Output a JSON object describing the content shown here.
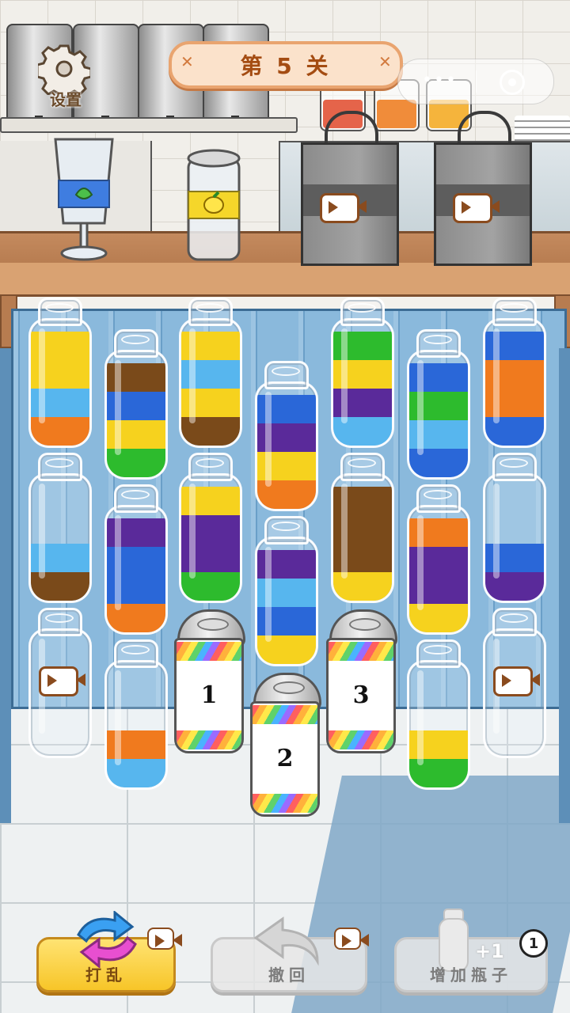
{
  "header": {
    "level_title": "第 5 关",
    "settings_label": "设置"
  },
  "bottles": [
    {
      "id": 1,
      "layers": [
        "#f07a1e",
        "#57b6ee",
        "#f6d21e",
        "#f6d21e"
      ]
    },
    {
      "id": 2,
      "layers": [
        "#2dbb2d",
        "#f6d21e",
        "#2a67d8",
        "#7a4a1a"
      ]
    },
    {
      "id": 3,
      "layers": [
        "#7a4a1a",
        "#f6d21e",
        "#57b6ee",
        "#f6d21e"
      ]
    },
    {
      "id": 4,
      "layers": [
        "#f07a1e",
        "#f6d21e",
        "#5a2a9a",
        "#2a67d8"
      ]
    },
    {
      "id": 5,
      "layers": [
        "#2dbb2d",
        "#5a2a9a",
        "#5a2a9a",
        "#f6d21e"
      ]
    },
    {
      "id": 6,
      "layers": [
        "#2a67d8",
        "#57b6ee",
        "#2dbb2d",
        "#2a67d8"
      ]
    },
    {
      "id": 7,
      "layers": [
        "#2a67d8",
        "#f07a1e",
        "#f07a1e",
        "#2a67d8"
      ]
    },
    {
      "id": 8,
      "layers": [
        "#7a4a1a",
        "#57b6ee"
      ]
    },
    {
      "id": 9,
      "layers": [
        "#f07a1e",
        "#2a67d8",
        "#2a67d8",
        "#5a2a9a"
      ]
    },
    {
      "id": 10,
      "layers": [
        "#57b6ee",
        "#5a2a9a",
        "#f6d21e",
        "#2dbb2d"
      ]
    },
    {
      "id": 11,
      "layers": [
        "#f6d21e",
        "#2a67d8",
        "#57b6ee",
        "#5a2a9a"
      ]
    },
    {
      "id": 12,
      "layers": [
        "#f6d21e",
        "#7a4a1a",
        "#7a4a1a",
        "#7a4a1a"
      ]
    },
    {
      "id": 13,
      "layers": [
        "#f6d21e",
        "#5a2a9a",
        "#5a2a9a",
        "#f07a1e"
      ]
    },
    {
      "id": 14,
      "layers": [
        "#5a2a9a",
        "#2a67d8"
      ]
    },
    {
      "id": 15,
      "layers": [],
      "locked_video": true
    },
    {
      "id": 16,
      "layers": [
        "#57b6ee",
        "#f07a1e"
      ]
    },
    {
      "id": 17,
      "layers": [
        "#2dbb2d",
        "#f6d21e"
      ]
    },
    {
      "id": 18,
      "layers": [],
      "locked_video": true
    }
  ],
  "mystery_cups": [
    {
      "label": "1"
    },
    {
      "label": "2"
    },
    {
      "label": "3"
    }
  ],
  "counter": {
    "cup_icon": "leaf-glass-icon",
    "can_icon": "lemon-can-icon",
    "bags": [
      {
        "icon": "video-icon"
      },
      {
        "icon": "video-icon"
      }
    ]
  },
  "buttons": {
    "shuffle": {
      "label": "打乱",
      "icon": "shuffle-icon"
    },
    "undo": {
      "label": "撤回",
      "icon": "undo-icon"
    },
    "add_bottle": {
      "label": "增加瓶子",
      "badge": "1",
      "bonus": "+1"
    }
  },
  "colors": {
    "yellow": "#f6d21e",
    "blue": "#2a67d8",
    "light_blue": "#57b6ee",
    "orange": "#f07a1e",
    "green": "#2dbb2d",
    "purple": "#5a2a9a",
    "brown": "#7a4a1a"
  }
}
